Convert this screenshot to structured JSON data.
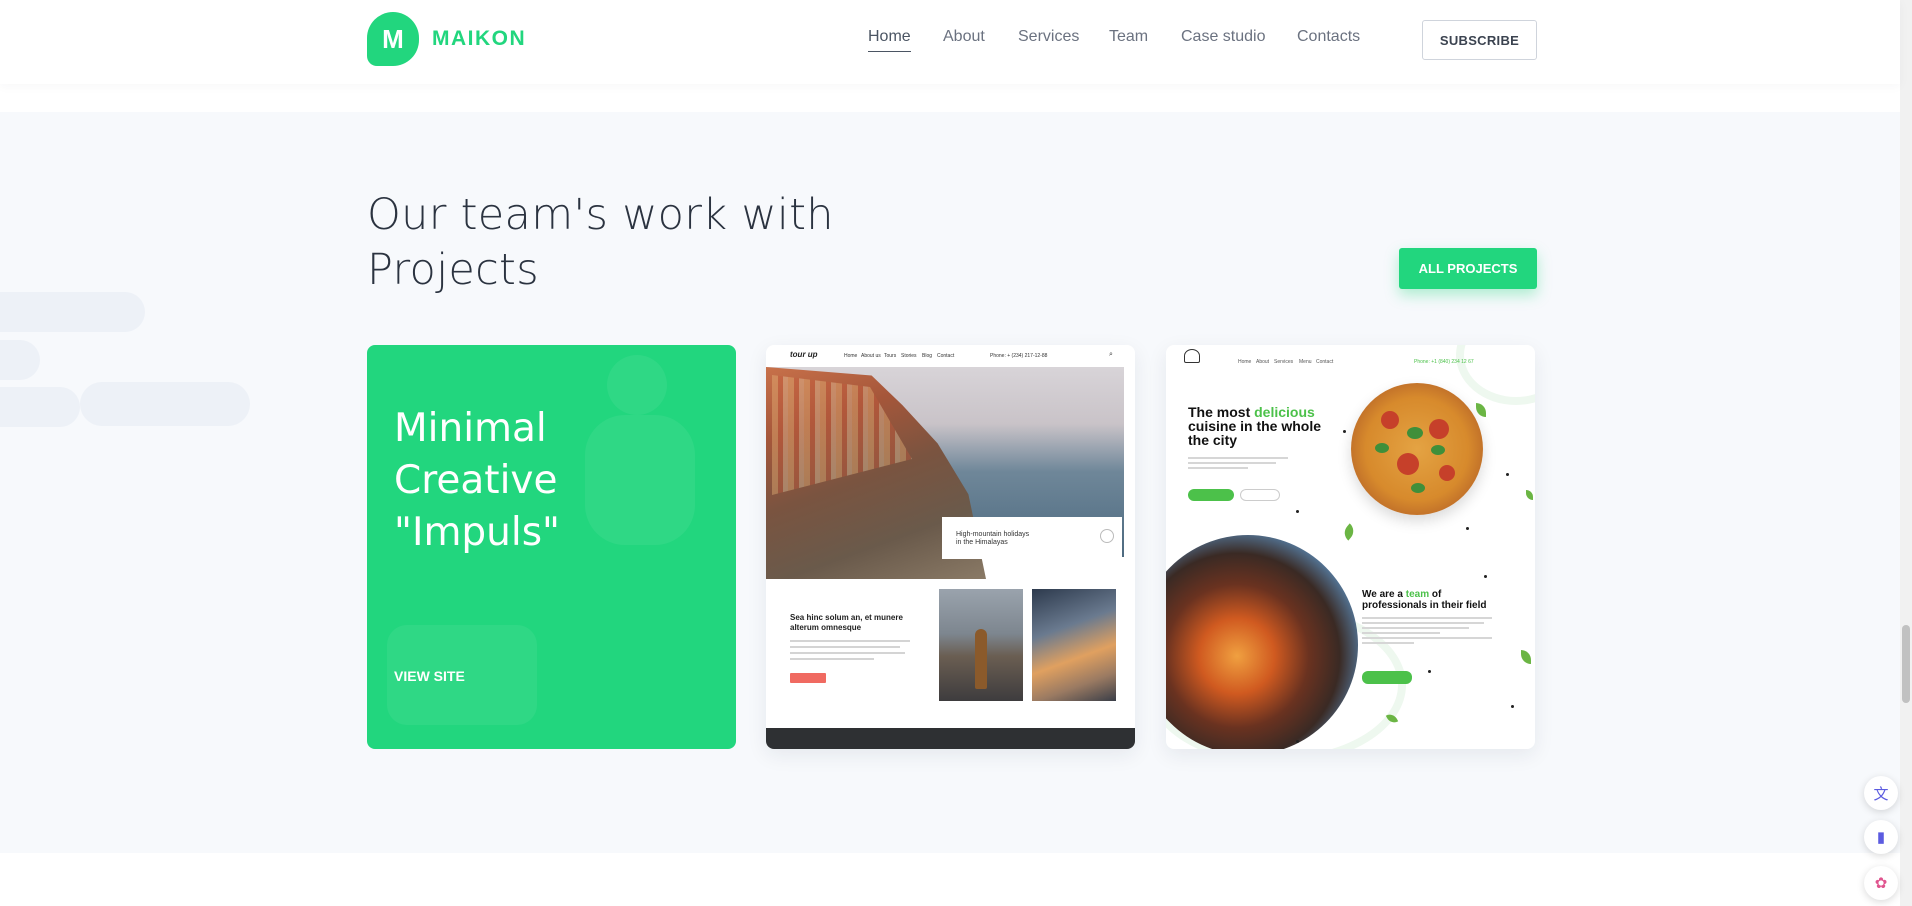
{
  "header": {
    "logo_letter": "M",
    "logo_text": "MAIKON",
    "nav": [
      "Home",
      "About",
      "Services",
      "Team",
      "Case studio",
      "Contacts"
    ],
    "active_nav": "Home",
    "subscribe_label": "SUBSCRIBE"
  },
  "section": {
    "title_line1": "Our team's work with",
    "title_line2": "Projects",
    "all_projects_label": "ALL PROJECTS"
  },
  "projects": [
    {
      "title_line1": "Minimal Creative",
      "title_line2": "\"Impuls\"",
      "link_label": "VIEW SITE"
    },
    {
      "mockup": "travel-site",
      "logo": "tour up",
      "nav": [
        "Home",
        "About us",
        "Tours",
        "Stories",
        "Blog",
        "Contact"
      ],
      "phone": "Phone: + (234) 217-12-88",
      "hero_caption_line1": "High-mountain holidays",
      "hero_caption_line2": "in the Himalayas",
      "blog_heading": "Sea hinc solum an, et munere alterum omnesque"
    },
    {
      "mockup": "pizza-site",
      "nav": [
        "Home",
        "About",
        "Services",
        "Menu",
        "Contact"
      ],
      "phone": "Phone: +1 (840) 234 12 67",
      "heading_pre": "The most ",
      "heading_accent": "delicious",
      "heading_post": " cuisine in the whole the city",
      "team_pre": "We are a ",
      "team_accent": "team",
      "team_post": " of professionals in their field"
    }
  ],
  "colors": {
    "brand_green": "#22d67e",
    "mockup_green": "#4cc14a",
    "mockup_red": "#f06a61"
  },
  "icons": [
    "translate-icon",
    "reader-icon",
    "brain-icon"
  ]
}
